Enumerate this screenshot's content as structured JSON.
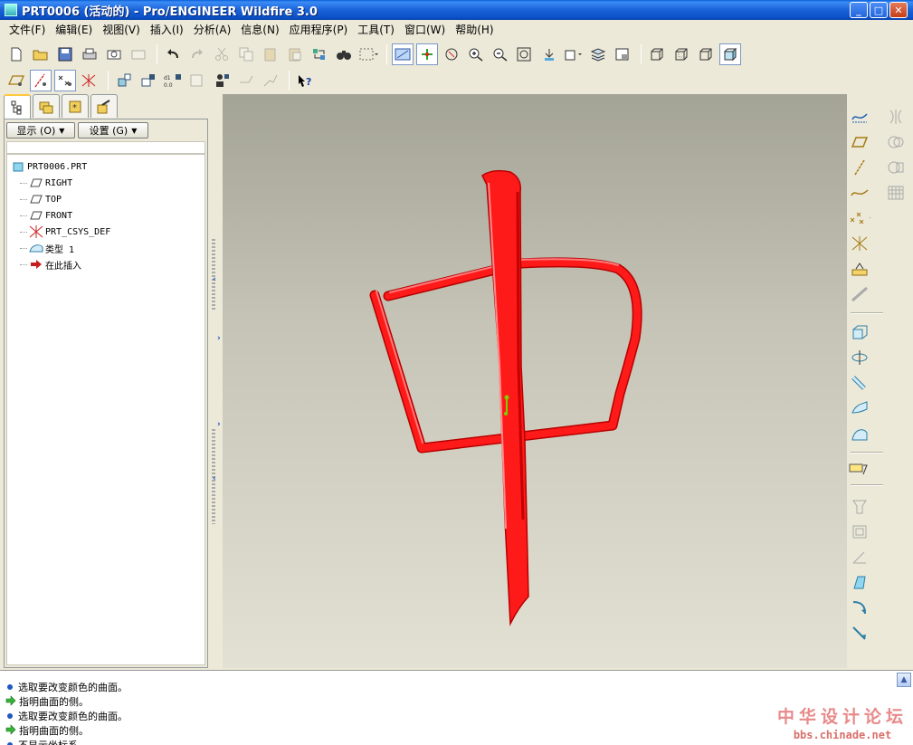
{
  "window": {
    "title": "PRT0006 (活动的) - Pro/ENGINEER Wildfire 3.0",
    "minimize": "_",
    "maximize": "□",
    "close": "✕"
  },
  "menu": [
    "文件(F)",
    "编辑(E)",
    "视图(V)",
    "插入(I)",
    "分析(A)",
    "信息(N)",
    "应用程序(P)",
    "工具(T)",
    "窗口(W)",
    "帮助(H)"
  ],
  "navigator": {
    "show_label": "显示 (O)",
    "settings_label": "设置 (G)",
    "tree": [
      {
        "label": "PRT0006.PRT",
        "icon": "part-icon"
      },
      {
        "label": "RIGHT",
        "icon": "datum-plane-icon"
      },
      {
        "label": "TOP",
        "icon": "datum-plane-icon"
      },
      {
        "label": "FRONT",
        "icon": "datum-plane-icon"
      },
      {
        "label": "PRT_CSYS_DEF",
        "icon": "csys-icon"
      },
      {
        "label": "类型 1",
        "icon": "surface-icon"
      },
      {
        "label": "在此插入",
        "icon": "insert-here-arrow-icon"
      }
    ]
  },
  "messages": [
    {
      "type": "info",
      "text": "选取要改变颜色的曲面。"
    },
    {
      "type": "prompt",
      "text": "指明曲面的侧。"
    },
    {
      "type": "info",
      "text": "选取要改变颜色的曲面。"
    },
    {
      "type": "prompt",
      "text": "指明曲面的侧。"
    },
    {
      "type": "info",
      "text": "不显示坐标系"
    }
  ],
  "watermark": {
    "line1": "中华设计论坛",
    "line2": "bbs.chinade.net"
  },
  "colors": {
    "model": "#ff1a1a",
    "model_shadow": "#c00000",
    "accent": "#1f57c4"
  }
}
